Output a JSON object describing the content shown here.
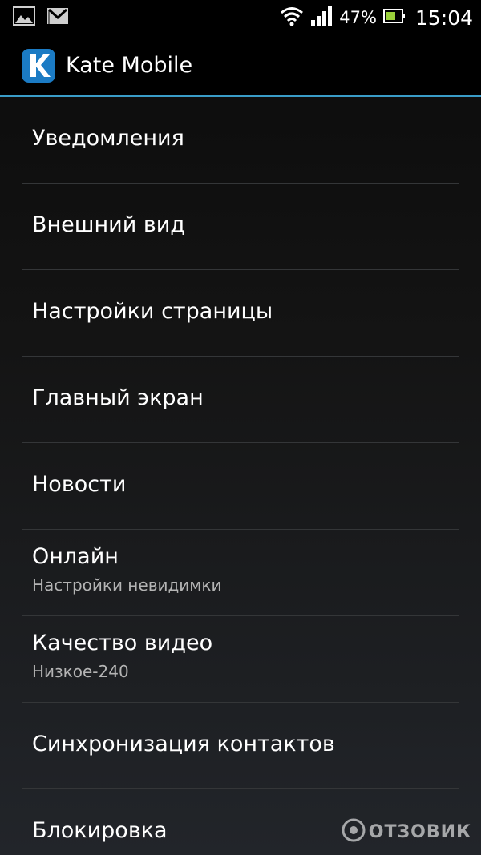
{
  "status_bar": {
    "notifications": [
      "gallery-icon",
      "gmail-icon"
    ],
    "battery_percent": "47%",
    "time": "15:04"
  },
  "action_bar": {
    "title": "Kate Mobile",
    "accent": "#3a9cc8"
  },
  "settings": {
    "items": [
      {
        "title": "Уведомления",
        "summary": ""
      },
      {
        "title": "Внешний вид",
        "summary": ""
      },
      {
        "title": "Настройки страницы",
        "summary": ""
      },
      {
        "title": "Главный экран",
        "summary": ""
      },
      {
        "title": "Новости",
        "summary": ""
      },
      {
        "title": "Онлайн",
        "summary": "Настройки невидимки"
      },
      {
        "title": "Качество видео",
        "summary": "Низкое-240"
      },
      {
        "title": "Синхронизация контактов",
        "summary": ""
      },
      {
        "title": "Блокировка",
        "summary": ""
      }
    ]
  },
  "watermark": {
    "text": "ОТЗОВИК"
  }
}
